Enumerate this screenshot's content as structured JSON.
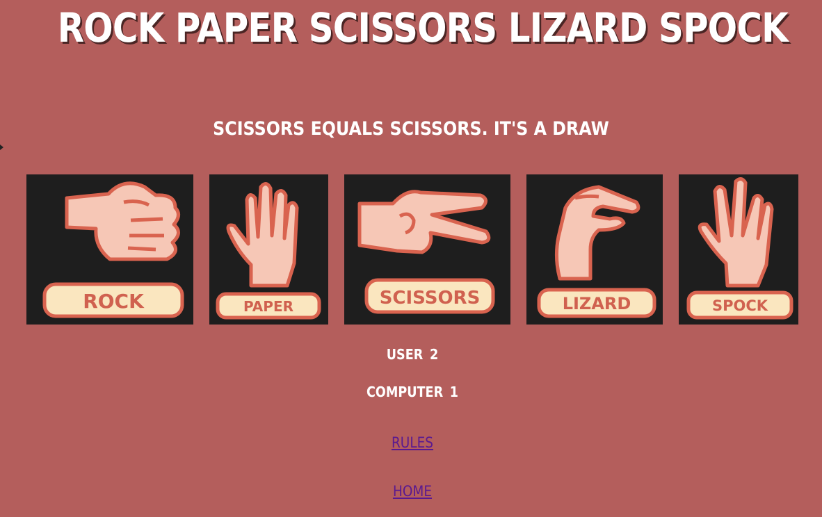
{
  "title": "ROCK PAPER SCISSORS LIZARD SPOCK",
  "result_message": "SCISSORS EQUALS SCISSORS. IT'S A DRAW",
  "choices": [
    {
      "id": "rock",
      "label": "ROCK"
    },
    {
      "id": "paper",
      "label": "PAPER"
    },
    {
      "id": "scissors",
      "label": "SCISSORS"
    },
    {
      "id": "lizard",
      "label": "LIZARD"
    },
    {
      "id": "spock",
      "label": "SPOCK"
    }
  ],
  "score": {
    "user_label": "USER",
    "user_value": "2",
    "computer_label": "COMPUTER",
    "computer_value": "1"
  },
  "nav": {
    "rules": "RULES",
    "home": "HOME"
  },
  "colors": {
    "background": "#b45e5c",
    "card_background": "#1e1e1e",
    "hand_fill": "#f6c7b6",
    "hand_outline": "#d9634f",
    "label_fill": "#fae6bf",
    "link": "#5a1990"
  }
}
